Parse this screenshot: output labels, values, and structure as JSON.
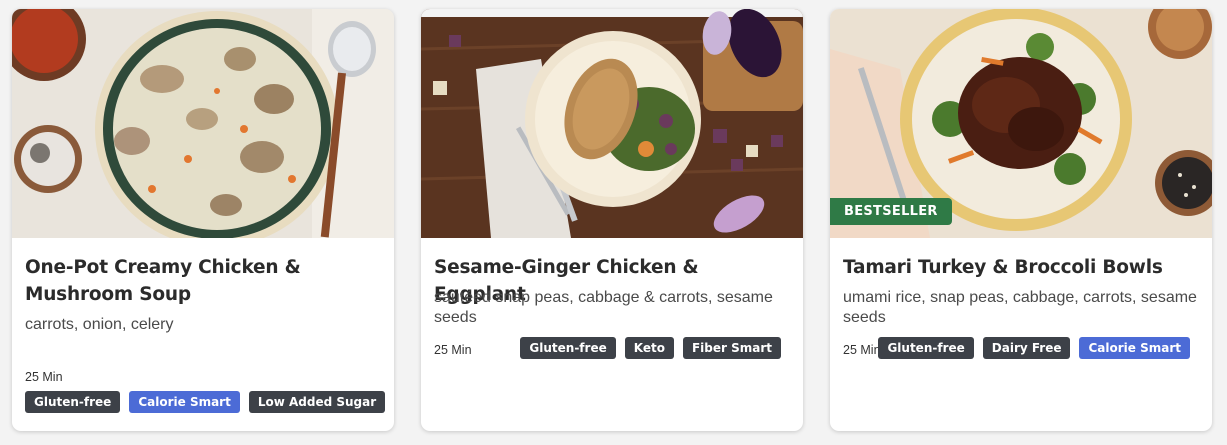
{
  "cards": [
    {
      "title": "One-Pot Creamy Chicken & Mushroom Soup",
      "subtitle": "carrots, onion, celery",
      "time": "25 Min",
      "badge": "",
      "tags": [
        {
          "label": "Gluten-free",
          "style": "dark"
        },
        {
          "label": "Calorie Smart",
          "style": "blue"
        },
        {
          "label": "Low Added Sugar",
          "style": "dark"
        }
      ]
    },
    {
      "title": "Sesame-Ginger Chicken & Eggplant",
      "subtitle": "sautéed snap peas, cabbage & carrots, sesame seeds",
      "time": "25 Min",
      "badge": "",
      "tags": [
        {
          "label": "Gluten-free",
          "style": "dark"
        },
        {
          "label": "Keto",
          "style": "dark"
        },
        {
          "label": "Fiber Smart",
          "style": "dark"
        }
      ]
    },
    {
      "title": "Tamari Turkey & Broccoli Bowls",
      "subtitle": "umami rice, snap peas, cabbage, carrots, sesame seeds",
      "time": "25 Min",
      "badge": "BESTSELLER",
      "tags": [
        {
          "label": "Gluten-free",
          "style": "dark"
        },
        {
          "label": "Dairy Free",
          "style": "dark"
        },
        {
          "label": "Calorie Smart",
          "style": "blue"
        }
      ]
    }
  ],
  "colors": {
    "tag_dark": "#3d4148",
    "tag_blue": "#4c6bd6",
    "badge_green": "#2f7a46"
  }
}
